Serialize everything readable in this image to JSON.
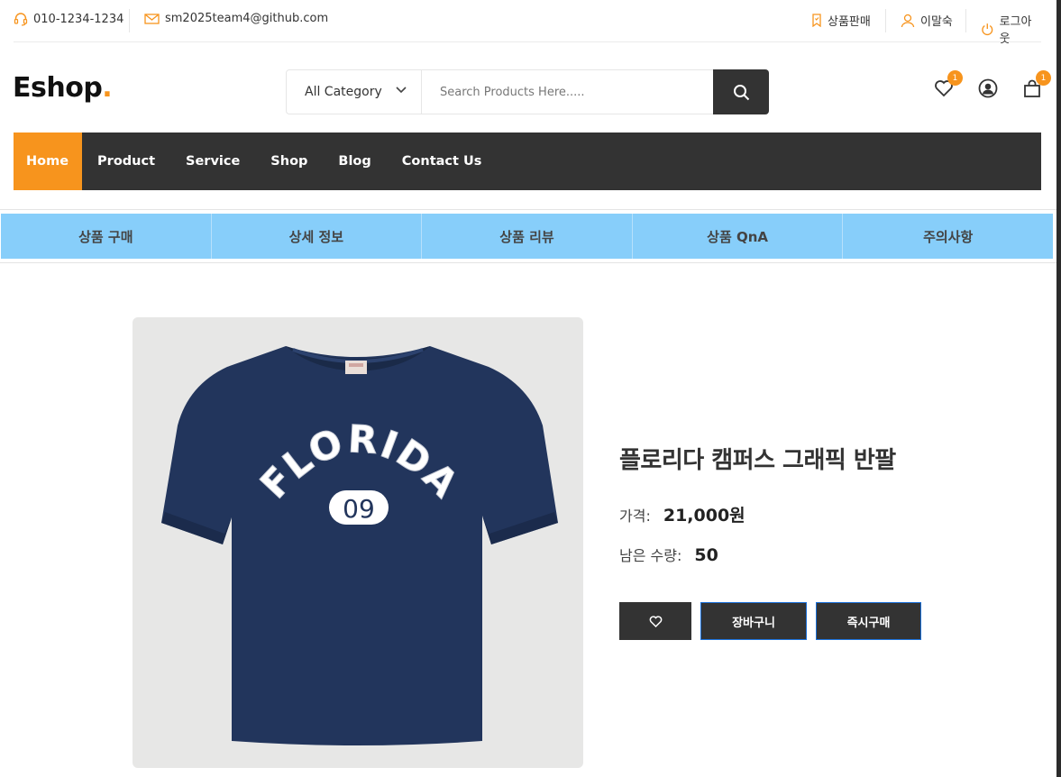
{
  "topbar": {
    "phone": "010-1234-1234",
    "email": "sm2025team4@github.com",
    "sell_label": "상품판매",
    "user_name": "이말숙",
    "logout_label": "로그아웃"
  },
  "header": {
    "logo_text": "Eshop",
    "logo_dot": ".",
    "category_label": "All Category",
    "search_placeholder": "Search Products Here.....",
    "wishlist_count": "1",
    "cart_count": "1"
  },
  "nav": {
    "items": [
      {
        "label": "Home",
        "active": true
      },
      {
        "label": "Product"
      },
      {
        "label": "Service"
      },
      {
        "label": "Shop"
      },
      {
        "label": "Blog"
      },
      {
        "label": "Contact Us"
      }
    ]
  },
  "tabs": [
    "상품 구매",
    "상세 정보",
    "상품 리뷰",
    "상품 QnA",
    "주의사항"
  ],
  "product": {
    "title": "플로리다 캠퍼스 그래픽 반팔",
    "price_label": "가격:",
    "price_value": "21,000원",
    "stock_label": "남은 수량:",
    "stock_value": "50",
    "shirt_print_text": "FLORIDA",
    "shirt_print_number": "09",
    "cart_button": "장바구니",
    "buy_button": "즉시구매"
  },
  "colors": {
    "accent": "#f7941d",
    "nav_bg": "#333333",
    "tab_bg": "#87cefa",
    "shirt": "#22355c"
  }
}
